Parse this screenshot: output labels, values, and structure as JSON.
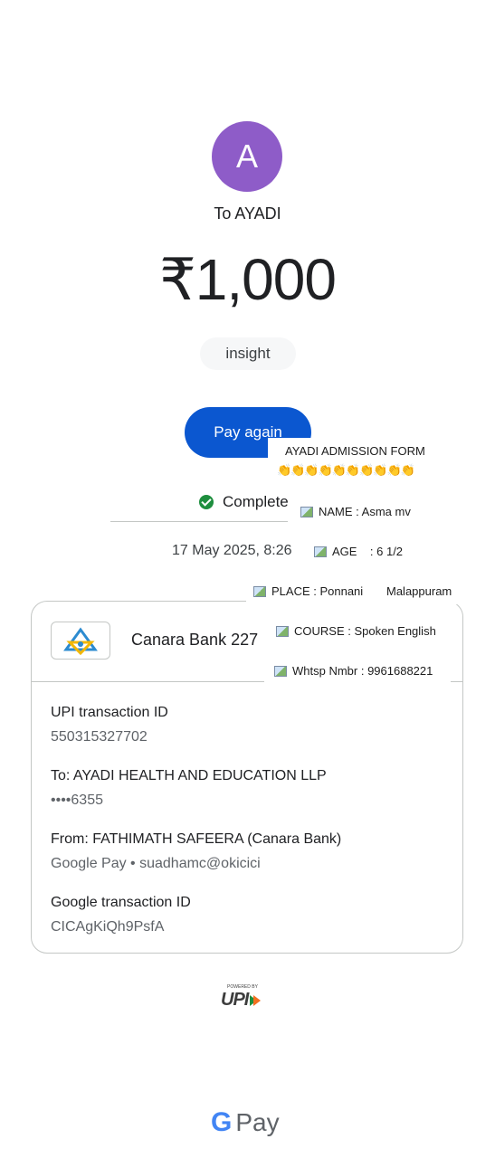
{
  "payee": {
    "avatar_letter": "A",
    "avatar_color": "#8e5cc8",
    "to_label": "To AYADI"
  },
  "amount": "₹1,000",
  "note": "insight",
  "pay_again_label": "Pay again",
  "status": {
    "label": "Complete",
    "datetime": "17 May 2025, 8:26"
  },
  "bank": {
    "name": "Canara Bank 227"
  },
  "details": {
    "upi_txn_label": "UPI transaction ID",
    "upi_txn_value": "550315327702",
    "to_label": "To: AYADI HEALTH AND EDUCATION LLP",
    "to_value": "••••6355",
    "from_label": "From: FATHIMATH  SAFEERA (Canara Bank)",
    "from_value": "Google Pay • suadhamc@okicici",
    "google_txn_label": "Google transaction ID",
    "google_txn_value": "CICAgKiQh9PsfA"
  },
  "footer": {
    "upi_powered": "POWERED BY",
    "upi_mark": "UPI",
    "brand_g": "G",
    "brand_pay": "Pay"
  },
  "overlay": {
    "title": "AYADI ADMISSION FORM",
    "emoji_row": "👏👏👏👏👏👏👏👏👏👏",
    "name": "NAME : Asma mv",
    "age": "AGE    : 6 1/2",
    "place": "PLACE : Ponnani",
    "place_extra": "Malappuram",
    "course": "COURSE : Spoken English",
    "whatsapp": "Whtsp Nmbr : 9961688221"
  },
  "colors": {
    "primary_button": "#0b57d0",
    "success": "#1e8e3e"
  }
}
